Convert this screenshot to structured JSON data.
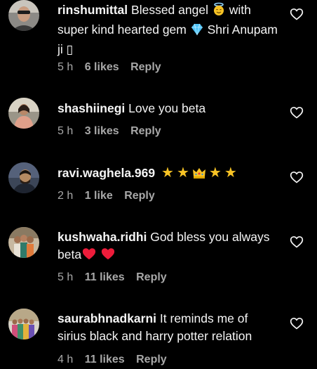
{
  "comments": [
    {
      "username": "rinshumittal",
      "text_before": "Blessed angel",
      "text_mid": "with super kind hearted gem",
      "text_after": "Shri Anupam ji",
      "tofu": "▯",
      "time": "5 h",
      "likes": "6 likes",
      "reply": "Reply"
    },
    {
      "username": "shashiinegi",
      "text": "Love you beta",
      "time": "5 h",
      "likes": "3 likes",
      "reply": "Reply"
    },
    {
      "username": "ravi.waghela.969",
      "star": "★",
      "crown": "👑",
      "time": "2 h",
      "likes": "1 like",
      "reply": "Reply"
    },
    {
      "username": "kushwaha.ridhi",
      "text": "God bless you always beta",
      "time": "5 h",
      "likes": "11 likes",
      "reply": "Reply"
    },
    {
      "username": "saurabhnadkarni",
      "text": "It reminds me of sirius black and harry potter relation",
      "time": "4 h",
      "likes": "11 likes",
      "reply": "Reply"
    }
  ],
  "colors": {
    "background": "#000000",
    "primary_text": "#f5f5f5",
    "secondary_text": "#a8a8a8",
    "heart_red": "#ed1c3a",
    "star_gold": "#f7c325"
  }
}
